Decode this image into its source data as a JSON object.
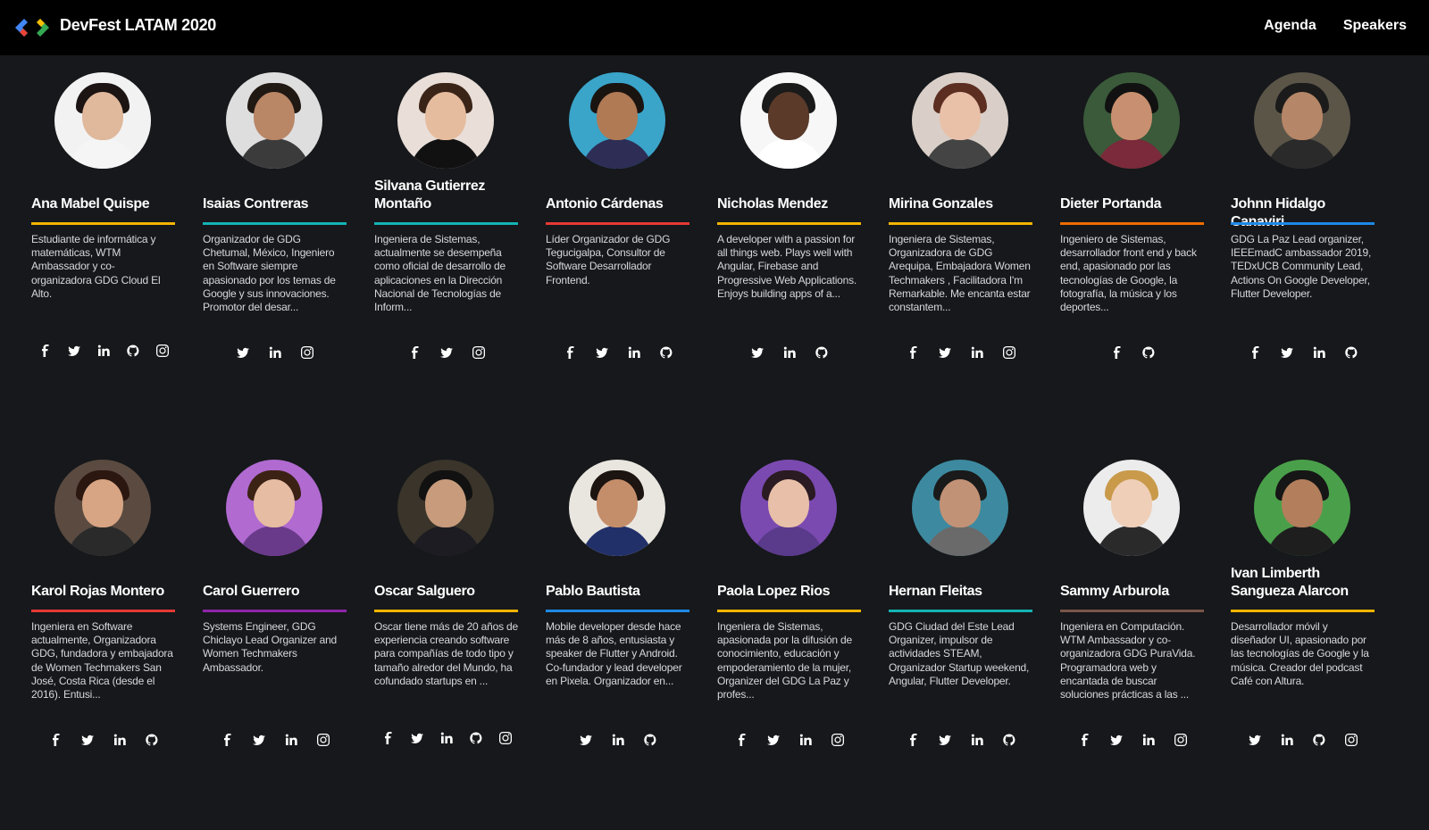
{
  "app": {
    "title": "DevFest LATAM 2020"
  },
  "nav": {
    "agenda": "Agenda",
    "speakers": "Speakers"
  },
  "colors": {
    "background": "#16181b",
    "topbar": "#000000",
    "yellow": "#f4b400",
    "teal": "#13b3b3",
    "blue": "#1e88e5",
    "red": "#e53935",
    "orange": "#ef6c00",
    "purple": "#8e24aa",
    "brown": "#795548"
  },
  "speakers": [
    {
      "name": "Ana Mabel Quispe",
      "accent": "#f4b400",
      "bio": "Estudiante de informática y matemáticas, WTM Ambassador y co-organizadora GDG Cloud El Alto.",
      "socials": [
        "facebook-icon",
        "twitter-icon",
        "linkedin-icon",
        "github-icon",
        "instagram-icon"
      ]
    },
    {
      "name": "Isaias Contreras",
      "accent": "#13b3b3",
      "bio": "Organizador de GDG Chetumal, México, Ingeniero en Software siempre apasionado por los temas de Google y sus innovaciones. Promotor del desar...",
      "socials": [
        "twitter-icon",
        "linkedin-icon",
        "instagram-icon"
      ]
    },
    {
      "name": "Silvana Gutierrez Montaño",
      "accent": "#13b3b3",
      "bio": "Ingeniera de Sistemas, actualmente se desempeña como oficial de desarrollo de aplicaciones en la Dirección Nacional de Tecnologías de Inform...",
      "socials": [
        "facebook-icon",
        "twitter-icon",
        "instagram-icon"
      ]
    },
    {
      "name": "Antonio Cárdenas",
      "accent": "#e53935",
      "bio": "Líder Organizador de GDG Tegucigalpa, Consultor de Software Desarrollador Frontend.",
      "socials": [
        "facebook-icon",
        "twitter-icon",
        "linkedin-icon",
        "github-icon"
      ]
    },
    {
      "name": "Nicholas Mendez",
      "accent": "#f4b400",
      "bio": "A developer with a passion for all things web. Plays well with Angular, Firebase and Progressive Web Applications. Enjoys building apps of a...",
      "socials": [
        "twitter-icon",
        "linkedin-icon",
        "github-icon"
      ]
    },
    {
      "name": "Mirina Gonzales",
      "accent": "#f4b400",
      "bio": "Ingeniera de Sistemas, Organizadora de GDG Arequipa,  Embajadora Women Techmakers , Facilitadora I'm Remarkable. Me encanta estar constantem...",
      "socials": [
        "facebook-icon",
        "twitter-icon",
        "linkedin-icon",
        "instagram-icon"
      ]
    },
    {
      "name": "Dieter Portanda",
      "accent": "#ef6c00",
      "bio": "Ingeniero de Sistemas, desarrollador front end y back end, apasionado por las tecnologías de Google, la fotografía, la música y los deportes...",
      "socials": [
        "facebook-icon",
        "github-icon"
      ]
    },
    {
      "name": "Johnn Hidalgo Canaviri",
      "accent": "#1e88e5",
      "bio": "GDG La Paz Lead organizer, IEEEmadC ambassador 2019, TEDxUCB Community Lead, Actions On Google Developer, Flutter Developer.",
      "socials": [
        "facebook-icon",
        "twitter-icon",
        "linkedin-icon",
        "github-icon"
      ]
    },
    {
      "name": "Karol Rojas Montero",
      "accent": "#e53935",
      "bio": "Ingeniera en Software actualmente, Organizadora GDG, fundadora y embajadora de Women Techmakers San José, Costa Rica (desde el 2016). Entusi...",
      "socials": [
        "facebook-icon",
        "twitter-icon",
        "linkedin-icon",
        "github-icon"
      ]
    },
    {
      "name": "Carol Guerrero",
      "accent": "#8e24aa",
      "bio": "Systems Engineer, GDG Chiclayo Lead Organizer and Women Techmakers Ambassador.",
      "socials": [
        "facebook-icon",
        "twitter-icon",
        "linkedin-icon",
        "instagram-icon"
      ]
    },
    {
      "name": "Oscar Salguero",
      "accent": "#f4b400",
      "bio": "Oscar tiene más de 20 años de experiencia creando software para compañías de todo tipo y tamaño alredor del Mundo, ha cofundado startups en ...",
      "socials": [
        "facebook-icon",
        "twitter-icon",
        "linkedin-icon",
        "github-icon",
        "instagram-icon"
      ]
    },
    {
      "name": "Pablo Bautista",
      "accent": "#1e88e5",
      "bio": "Mobile developer desde hace más de 8 años, entusiasta y speaker de Flutter y Android. Co-fundador y lead developer en Pixela. Organizador en...",
      "socials": [
        "twitter-icon",
        "linkedin-icon",
        "github-icon"
      ]
    },
    {
      "name": "Paola Lopez Rios",
      "accent": "#f4b400",
      "bio": "Ingeniera de Sistemas, apasionada por la difusión de conocimiento, educación y empoderamiento de la mujer, Organizer del GDG La Paz y profes...",
      "socials": [
        "facebook-icon",
        "twitter-icon",
        "linkedin-icon",
        "instagram-icon"
      ]
    },
    {
      "name": "Hernan Fleitas",
      "accent": "#13b3b3",
      "bio": "GDG Ciudad del Este Lead Organizer, impulsor de actividades STEAM, Organizador Startup weekend, Angular, Flutter Developer.",
      "socials": [
        "facebook-icon",
        "twitter-icon",
        "linkedin-icon",
        "github-icon"
      ]
    },
    {
      "name": "Sammy Arburola",
      "accent": "#795548",
      "bio": "Ingeniera  en Computación. WTM Ambassador y co-organizadora GDG PuraVida. Programadora web y encantada de buscar soluciones prácticas a las ...",
      "socials": [
        "facebook-icon",
        "twitter-icon",
        "linkedin-icon",
        "instagram-icon"
      ]
    },
    {
      "name": "Ivan Limberth Sangueza Alarcon",
      "accent": "#f4b400",
      "bio": "Desarrollador móvil y diseñador UI, apasionado por las tecnologías de Google y la música. Creador del podcast Café con Altura.",
      "socials": [
        "twitter-icon",
        "linkedin-icon",
        "github-icon",
        "instagram-icon"
      ]
    }
  ]
}
